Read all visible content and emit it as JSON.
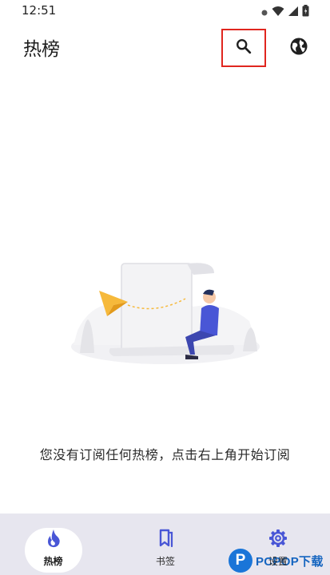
{
  "status_bar": {
    "time": "12:51"
  },
  "app_bar": {
    "title": "热榜"
  },
  "empty_state": {
    "message": "您没有订阅任何热榜，点击右上角开始订阅"
  },
  "bottom_nav": {
    "items": [
      {
        "label": "热榜",
        "icon": "flame-icon",
        "selected": true
      },
      {
        "label": "书签",
        "icon": "bookmark-icon",
        "selected": false
      },
      {
        "label": "设置",
        "icon": "gear-icon",
        "selected": false
      }
    ]
  },
  "watermark": {
    "logo_letter": "P",
    "text": "PCPOP下载"
  },
  "colors": {
    "accent": "#4956d6",
    "highlight_box": "#e0261f",
    "nav_background": "#e7e6ef"
  }
}
